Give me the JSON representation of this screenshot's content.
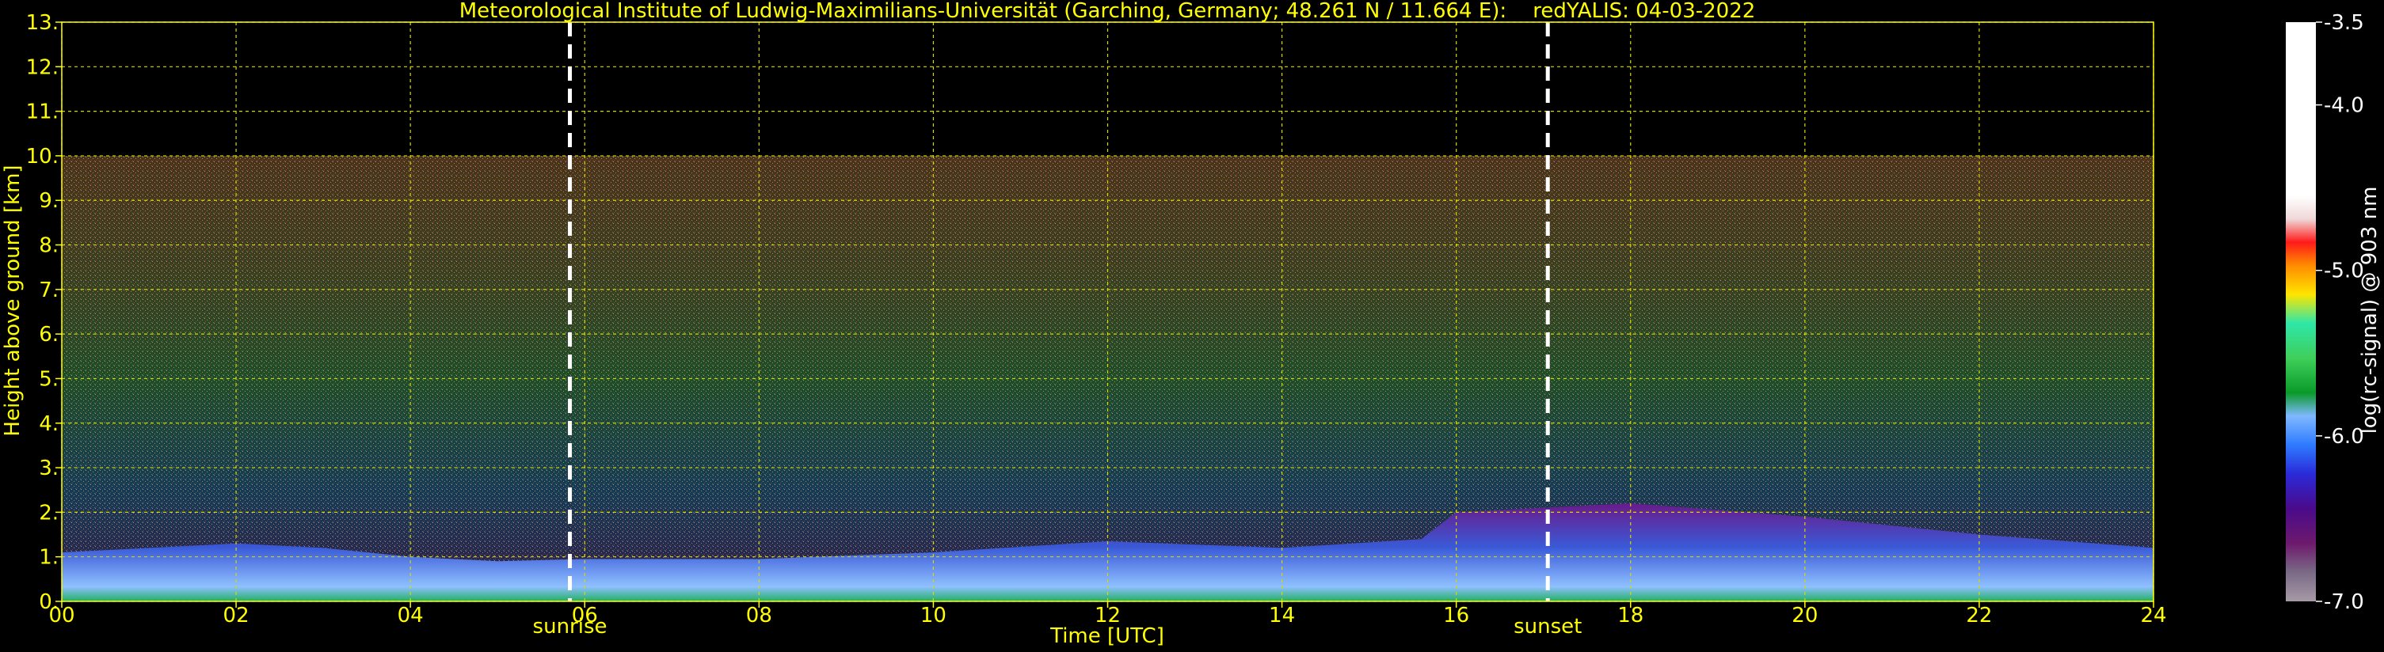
{
  "chart_data": {
    "type": "heatmap",
    "title": "Meteorological Institute of Ludwig-Maximilians-Universität (Garching, Germany; 48.261 N / 11.664 E):    redYALIS: 04-03-2022",
    "xlabel": "Time [UTC]",
    "ylabel": "Height above ground [km]",
    "xlim": [
      0,
      24
    ],
    "ylim": [
      0,
      13
    ],
    "x_ticks": [
      0,
      2,
      4,
      6,
      8,
      10,
      12,
      14,
      16,
      18,
      20,
      22,
      24
    ],
    "x_tick_labels": [
      "00",
      "02",
      "04",
      "06",
      "08",
      "10",
      "12",
      "14",
      "16",
      "18",
      "20",
      "22",
      "24"
    ],
    "y_ticks": [
      0,
      1,
      2,
      3,
      4,
      5,
      6,
      7,
      8,
      9,
      10,
      11,
      12,
      13
    ],
    "y_tick_labels": [
      "0.",
      "1.",
      "2.",
      "3.",
      "4.",
      "5.",
      "6.",
      "7.",
      "8.",
      "9.",
      "10.",
      "11.",
      "12.",
      "13."
    ],
    "grid": true,
    "signal_top_km": 10,
    "markers": [
      {
        "label": "sunrise",
        "time": 5.83
      },
      {
        "label": "sunset",
        "time": 17.05
      }
    ],
    "colorbar": {
      "label": "log(rc-signal) @ 903 nm",
      "range": [
        -7.0,
        -3.5
      ],
      "ticks": [
        -3.5,
        -4.0,
        -5.0,
        -6.0,
        -7.0
      ],
      "tick_labels": [
        "-3.5",
        "-4.0",
        "-5.0",
        "-6.0",
        "-7.0"
      ]
    },
    "boundary_layer_height_km": [
      {
        "t": 0,
        "h": 1.1
      },
      {
        "t": 2,
        "h": 1.3
      },
      {
        "t": 3,
        "h": 1.2
      },
      {
        "t": 4,
        "h": 1.0
      },
      {
        "t": 5,
        "h": 0.9
      },
      {
        "t": 6,
        "h": 0.95
      },
      {
        "t": 8,
        "h": 0.95
      },
      {
        "t": 10,
        "h": 1.1
      },
      {
        "t": 12,
        "h": 1.35
      },
      {
        "t": 14,
        "h": 1.2
      },
      {
        "t": 15.6,
        "h": 1.4
      },
      {
        "t": 16,
        "h": 2.0
      },
      {
        "t": 17,
        "h": 2.1
      },
      {
        "t": 18,
        "h": 2.2
      },
      {
        "t": 20,
        "h": 1.9
      },
      {
        "t": 22,
        "h": 1.5
      },
      {
        "t": 24,
        "h": 1.2
      }
    ]
  }
}
